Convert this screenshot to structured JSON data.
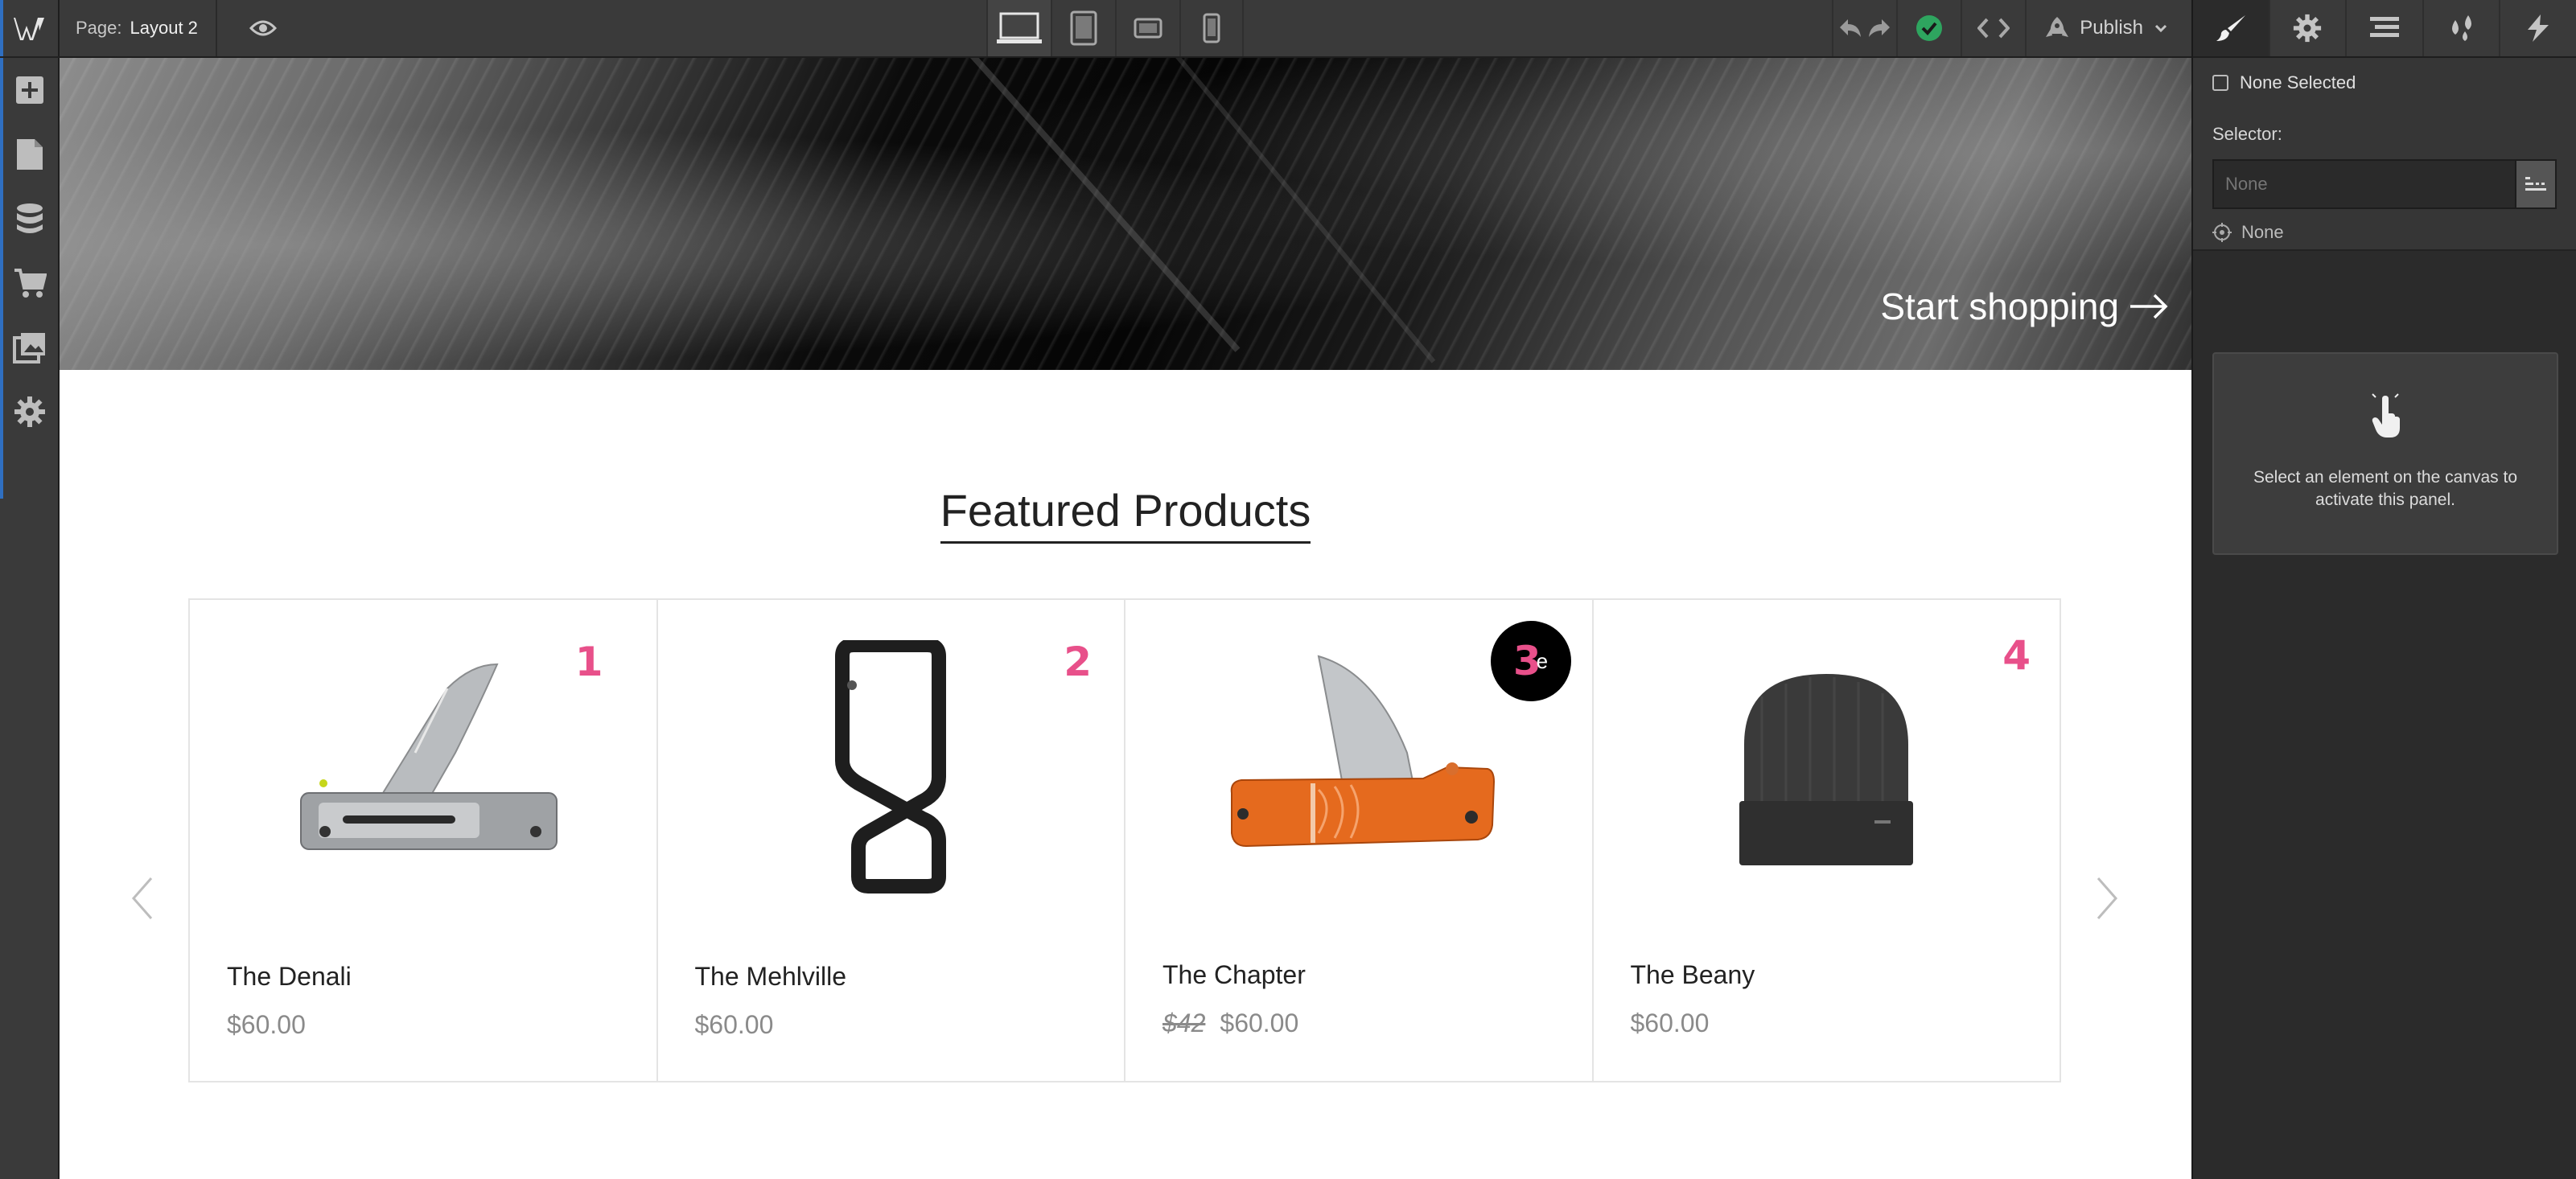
{
  "topbar": {
    "page_label": "Page:",
    "page_name": "Layout 2",
    "publish_label": "Publish"
  },
  "rail": {
    "logo": "W",
    "items": [
      "add-icon",
      "pages-icon",
      "cms-icon",
      "ecommerce-icon",
      "assets-icon",
      "settings-icon"
    ]
  },
  "devices": [
    "desktop",
    "tablet",
    "mobile-landscape",
    "mobile-portrait"
  ],
  "right_panel": {
    "tabs": [
      "style-icon",
      "settings-icon",
      "navigator-icon",
      "swatches-icon",
      "interactions-icon"
    ],
    "none_selected": "None Selected",
    "selector_label": "Selector:",
    "selector_placeholder": "None",
    "target_none": "None",
    "hint_message": "Select an element on the canvas to activate this panel."
  },
  "canvas": {
    "hero_link": "Start shopping",
    "section_title": "Featured Products",
    "products": [
      {
        "number": "1",
        "name": "The Denali",
        "price": "$60.00"
      },
      {
        "number": "2",
        "name": "The Mehlville",
        "price": "$60.00"
      },
      {
        "number": "3",
        "name": "The Chapter",
        "old_price": "$42",
        "price": "$60.00",
        "badge_text": "e"
      },
      {
        "number": "4",
        "name": "The Beany",
        "price": "$60.00"
      }
    ]
  },
  "colors": {
    "accent_blue": "#2f6fc1",
    "success_green": "#2ea55f",
    "badge_pink": "#e8508a",
    "knife_orange": "#e56a1e"
  }
}
